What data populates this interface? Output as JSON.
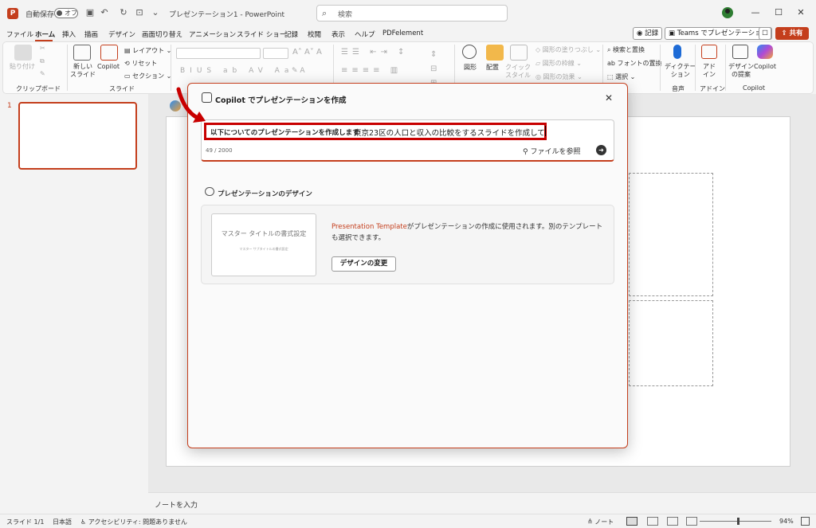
{
  "titlebar": {
    "autosave_label": "自動保存",
    "autosave_state": "オフ",
    "doc_title": "プレゼンテーション1 - PowerPoint",
    "search_placeholder": "検索"
  },
  "menu": {
    "tabs": [
      "ファイル",
      "ホーム",
      "挿入",
      "描画",
      "デザイン",
      "画面切り替え",
      "アニメーション",
      "スライド ショー",
      "記録",
      "校閲",
      "表示",
      "ヘルプ",
      "PDFelement"
    ],
    "active_tab": "ホーム",
    "record_button": "記録",
    "teams_button": "Teams でプレゼンテーション",
    "share_button": "共有"
  },
  "ribbon": {
    "clipboard": {
      "paste": "貼り付け",
      "label": "クリップボード"
    },
    "slides": {
      "new_slide": "新しい\nスライド",
      "copilot": "Copilot",
      "layout": "レイアウト",
      "reset": "リセット",
      "section": "セクション",
      "label": "スライド"
    },
    "drawing": {
      "shape": "図形",
      "arrange": "配置",
      "quick_style": "クイック\nスタイル",
      "fill": "図形の塗りつぶし",
      "outline": "図形の枠線",
      "effect": "図形の効果"
    },
    "editing": {
      "find_replace": "検索と置換",
      "replace_font": "フォントの置換",
      "select": "選択"
    },
    "voice": {
      "dictate": "ディクテー\nション",
      "label": "音声"
    },
    "addins": {
      "addin": "アド\nイン",
      "label": "アドイン"
    },
    "copilot": {
      "design_ideas": "デザイン\nの提案",
      "copilot": "Copilot",
      "label": "Copilot"
    }
  },
  "thumbnails": {
    "slide_number": "1"
  },
  "notes": {
    "placeholder": "ノートを入力"
  },
  "statusbar": {
    "slide_count": "スライド 1/1",
    "language": "日本語",
    "accessibility": "アクセシビリティ: 問題ありません",
    "notes_button": "ノート",
    "zoom": "94%",
    "zoom_fraction": 0.53
  },
  "dialog": {
    "title": "Copilot でプレゼンテーションを作成",
    "prompt_prefix": "以下についてのプレゼンテーションを作成します",
    "prompt_value": "東京23区の人口と収入の比較をするスライドを作成して",
    "char_counter": "49 / 2000",
    "attach_label": "ファイルを参照",
    "design_heading": "プレゼンテーションのデザイン",
    "template_thumb_title": "マスター タイトルの書式設定",
    "template_thumb_sub": "マスター サブタイトルの書式設定",
    "template_link": "Presentation Template",
    "template_desc": "がプレゼンテーションの作成に使用されます。別のテンプレートも選択できます。",
    "change_design_button": "デザインの変更"
  },
  "colors": {
    "accent": "#c43e1c",
    "highlight": "#c80000"
  }
}
